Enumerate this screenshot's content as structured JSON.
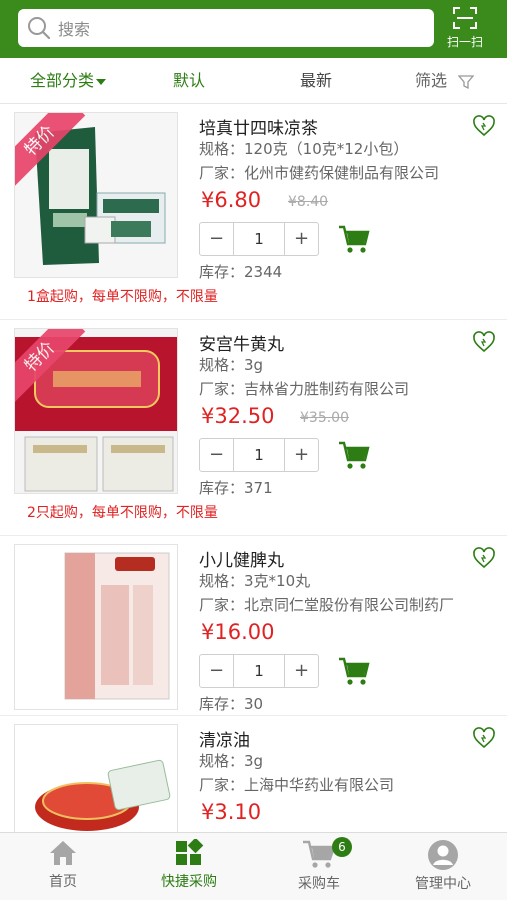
{
  "header": {
    "search_placeholder": "搜索",
    "scan_label": "扫一扫"
  },
  "filter_bar": {
    "category": "全部分类",
    "default": "默认",
    "latest": "最新",
    "filter": "筛选"
  },
  "labels": {
    "spec_prefix": "规格：",
    "maker_prefix": "厂家：",
    "stock_prefix": "库存：",
    "minus": "−",
    "plus": "+"
  },
  "products": [
    {
      "name": "培真廿四味凉茶",
      "spec": "120克（10克*12小包）",
      "manufacturer": "化州市健药保健制品有限公司",
      "price": "¥6.80",
      "original_price": "¥8.40",
      "quantity": "1",
      "stock": "2344",
      "min_purchase": "1盒起购，每单不限购，不限量",
      "ribbon": "特价"
    },
    {
      "name": "安宫牛黄丸",
      "spec": "3g",
      "manufacturer": "吉林省力胜制药有限公司",
      "price": "¥32.50",
      "original_price": "¥35.00",
      "quantity": "1",
      "stock": "371",
      "min_purchase": "2只起购，每单不限购，不限量",
      "ribbon": "特价"
    },
    {
      "name": "小儿健脾丸",
      "spec": "3克*10丸",
      "manufacturer": "北京同仁堂股份有限公司制药厂",
      "price": "¥16.00",
      "quantity": "1",
      "stock": "30"
    },
    {
      "name": "清凉油",
      "spec": "3g",
      "manufacturer": "上海中华药业有限公司",
      "price": "¥3.10"
    }
  ],
  "tabbar": {
    "home": "首页",
    "quick_buy": "快捷采购",
    "cart": "采购车",
    "cart_count": "6",
    "manage": "管理中心"
  },
  "colors": {
    "brand_green": "#3a8a1c",
    "price_red": "#e02222",
    "ribbon_pink": "#e8456b"
  }
}
